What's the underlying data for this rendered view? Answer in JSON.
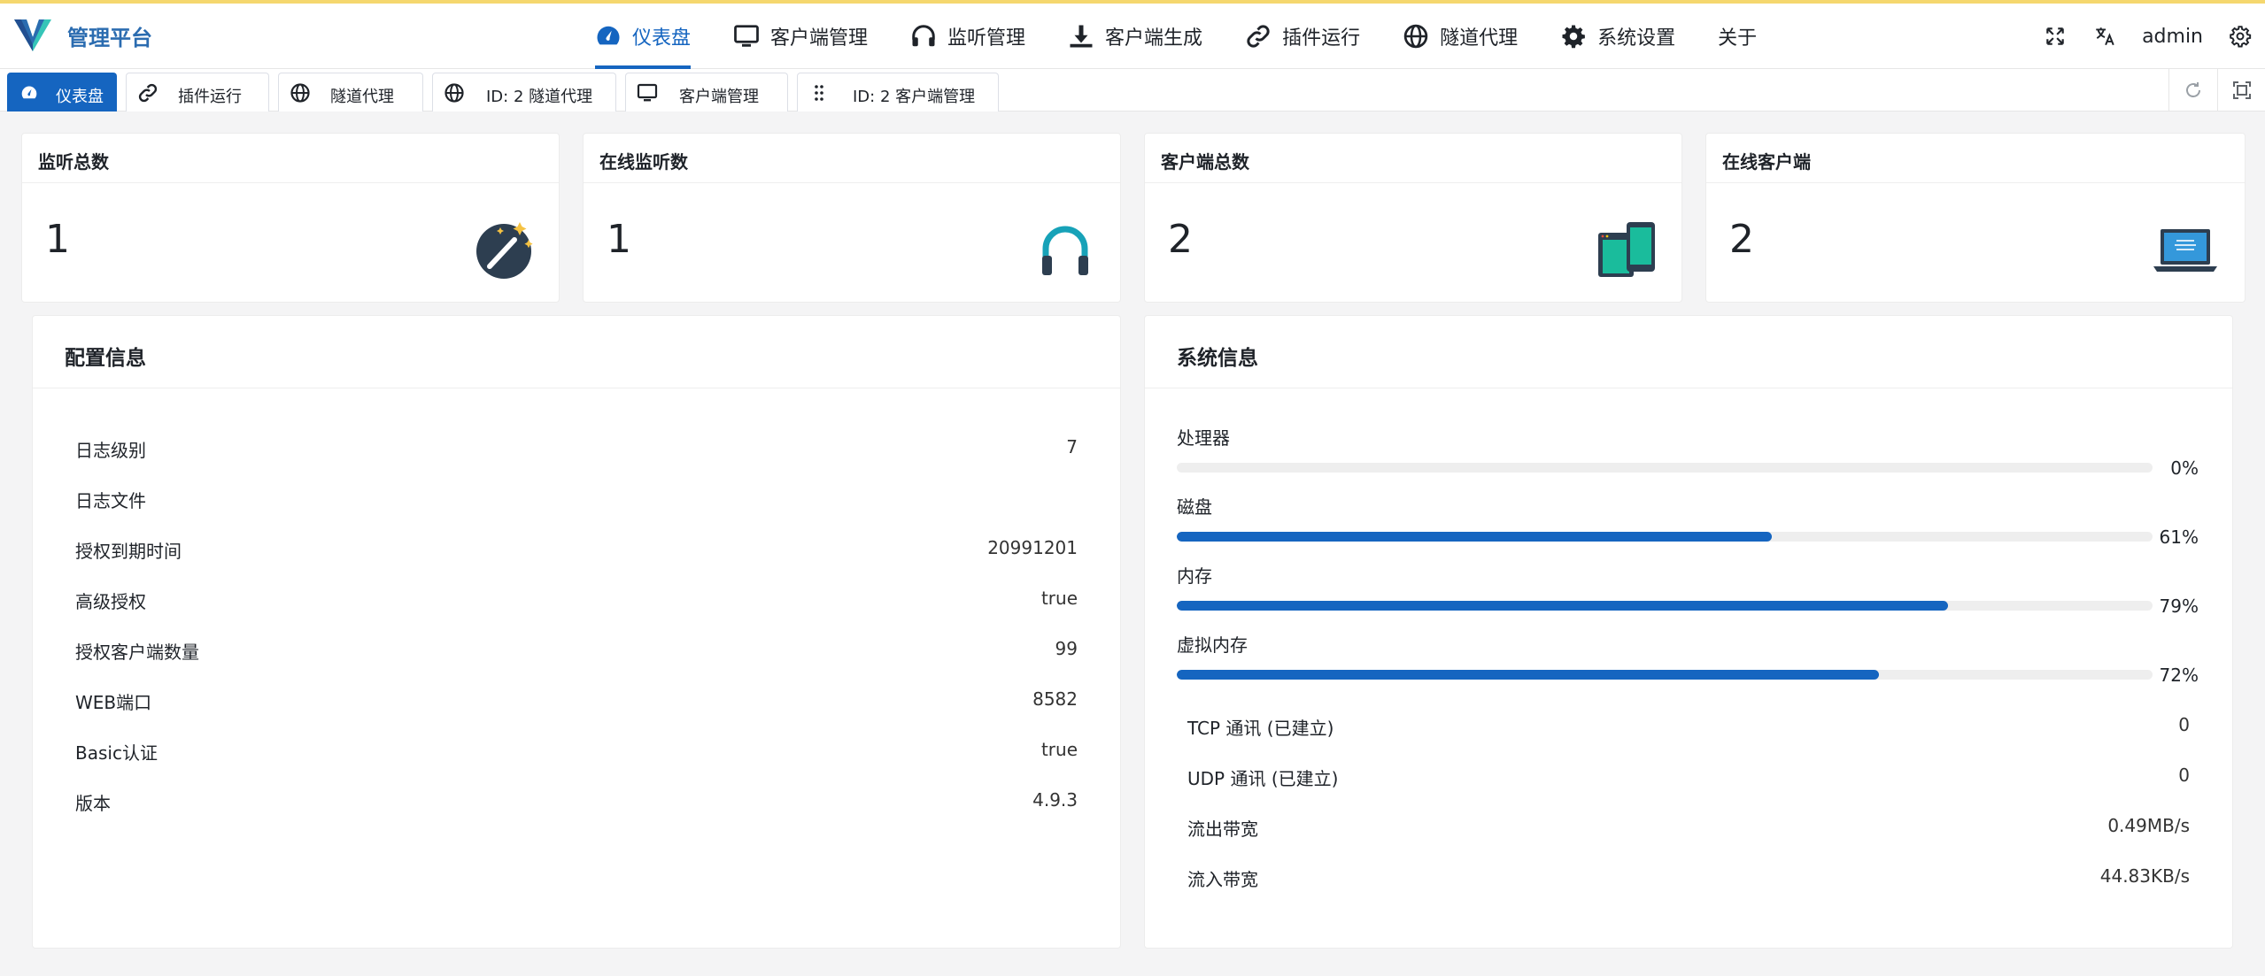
{
  "brand": {
    "title": "管理平台"
  },
  "nav": {
    "items": [
      {
        "label": "仪表盘",
        "icon": "dashboard-icon",
        "active": true
      },
      {
        "label": "客户端管理",
        "icon": "monitor-icon"
      },
      {
        "label": "监听管理",
        "icon": "headphones-icon"
      },
      {
        "label": "客户端生成",
        "icon": "download-icon"
      },
      {
        "label": "插件运行",
        "icon": "link-icon"
      },
      {
        "label": "隧道代理",
        "icon": "globe-icon"
      },
      {
        "label": "系统设置",
        "icon": "gear-icon"
      },
      {
        "label": "关于",
        "icon": ""
      }
    ]
  },
  "header_right": {
    "user": "admin"
  },
  "tabs": [
    {
      "label": "仪表盘",
      "icon": "dashboard-icon",
      "active": true
    },
    {
      "label": "插件运行",
      "icon": "link-icon"
    },
    {
      "label": "隧道代理",
      "icon": "globe-icon"
    },
    {
      "label": "ID: 2 隧道代理",
      "icon": "globe-icon"
    },
    {
      "label": "客户端管理",
      "icon": "monitor-icon"
    },
    {
      "label": "ID: 2 客户端管理",
      "icon": "grip-icon"
    }
  ],
  "stats": [
    {
      "title": "监听总数",
      "value": "1",
      "icon": "magic-wand-icon"
    },
    {
      "title": "在线监听数",
      "value": "1",
      "icon": "headphones-icon"
    },
    {
      "title": "客户端总数",
      "value": "2",
      "icon": "devices-icon"
    },
    {
      "title": "在线客户端",
      "value": "2",
      "icon": "laptop-icon"
    }
  ],
  "config": {
    "title": "配置信息",
    "rows": [
      {
        "key": "日志级别",
        "value": "7"
      },
      {
        "key": "日志文件",
        "value": ""
      },
      {
        "key": "授权到期时间",
        "value": "20991201"
      },
      {
        "key": "高级授权",
        "value": "true"
      },
      {
        "key": "授权客户端数量",
        "value": "99"
      },
      {
        "key": "WEB端口",
        "value": "8582"
      },
      {
        "key": "Basic认证",
        "value": "true"
      },
      {
        "key": "版本",
        "value": "4.9.3"
      }
    ]
  },
  "system": {
    "title": "系统信息",
    "meters": [
      {
        "label": "处理器",
        "percent": 0,
        "percent_text": "0%"
      },
      {
        "label": "磁盘",
        "percent": 61,
        "percent_text": "61%"
      },
      {
        "label": "内存",
        "percent": 79,
        "percent_text": "79%"
      },
      {
        "label": "虚拟内存",
        "percent": 72,
        "percent_text": "72%"
      }
    ],
    "rows": [
      {
        "key": "TCP 通讯 (已建立)",
        "value": "0"
      },
      {
        "key": "UDP 通讯 (已建立)",
        "value": "0"
      },
      {
        "key": "流出带宽",
        "value": "0.49MB/s"
      },
      {
        "key": "流入带宽",
        "value": "44.83KB/s"
      }
    ]
  },
  "colors": {
    "accent": "#1565c0",
    "brand": "#2b6cb0",
    "track": "#eeeeee",
    "bg": "#f4f4f5"
  }
}
